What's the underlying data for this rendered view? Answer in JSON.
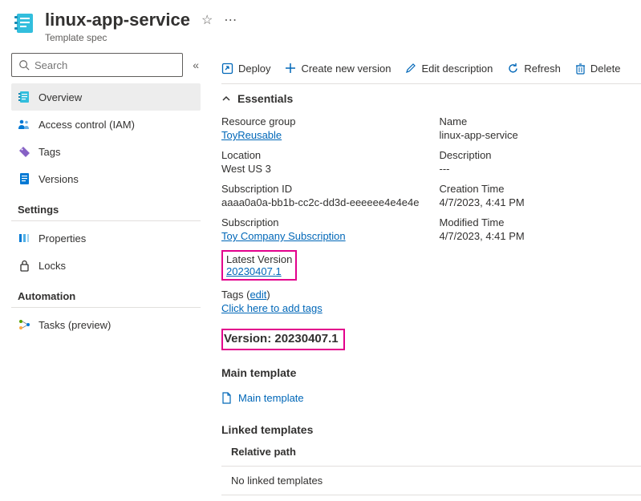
{
  "header": {
    "title": "linux-app-service",
    "subtitle": "Template spec"
  },
  "search": {
    "placeholder": "Search"
  },
  "nav": {
    "items": [
      {
        "label": "Overview"
      },
      {
        "label": "Access control (IAM)"
      },
      {
        "label": "Tags"
      },
      {
        "label": "Versions"
      }
    ],
    "settings_heading": "Settings",
    "settings": [
      {
        "label": "Properties"
      },
      {
        "label": "Locks"
      }
    ],
    "automation_heading": "Automation",
    "automation": [
      {
        "label": "Tasks (preview)"
      }
    ]
  },
  "toolbar": {
    "deploy": "Deploy",
    "create": "Create new version",
    "edit": "Edit description",
    "refresh": "Refresh",
    "delete": "Delete"
  },
  "essentials": {
    "heading": "Essentials",
    "left": {
      "rg_label": "Resource group",
      "rg_value": "ToyReusable",
      "loc_label": "Location",
      "loc_value": "West US 3",
      "subid_label": "Subscription ID",
      "subid_value": "aaaa0a0a-bb1b-cc2c-dd3d-eeeeee4e4e4e",
      "sub_label": "Subscription",
      "sub_value": "Toy Company Subscription",
      "latest_label": "Latest Version",
      "latest_value": "20230407.1",
      "tags_label": "Tags",
      "tags_edit": "edit",
      "tags_value": "Click here to add tags"
    },
    "right": {
      "name_label": "Name",
      "name_value": "linux-app-service",
      "desc_label": "Description",
      "desc_value": "---",
      "ctime_label": "Creation Time",
      "ctime_value": "4/7/2023, 4:41 PM",
      "mtime_label": "Modified Time",
      "mtime_value": "4/7/2023, 4:41 PM"
    }
  },
  "version_banner": "Version: 20230407.1",
  "main_template": {
    "heading": "Main template",
    "link": "Main template"
  },
  "linked_templates": {
    "heading": "Linked templates",
    "col": "Relative path",
    "empty": "No linked templates"
  }
}
